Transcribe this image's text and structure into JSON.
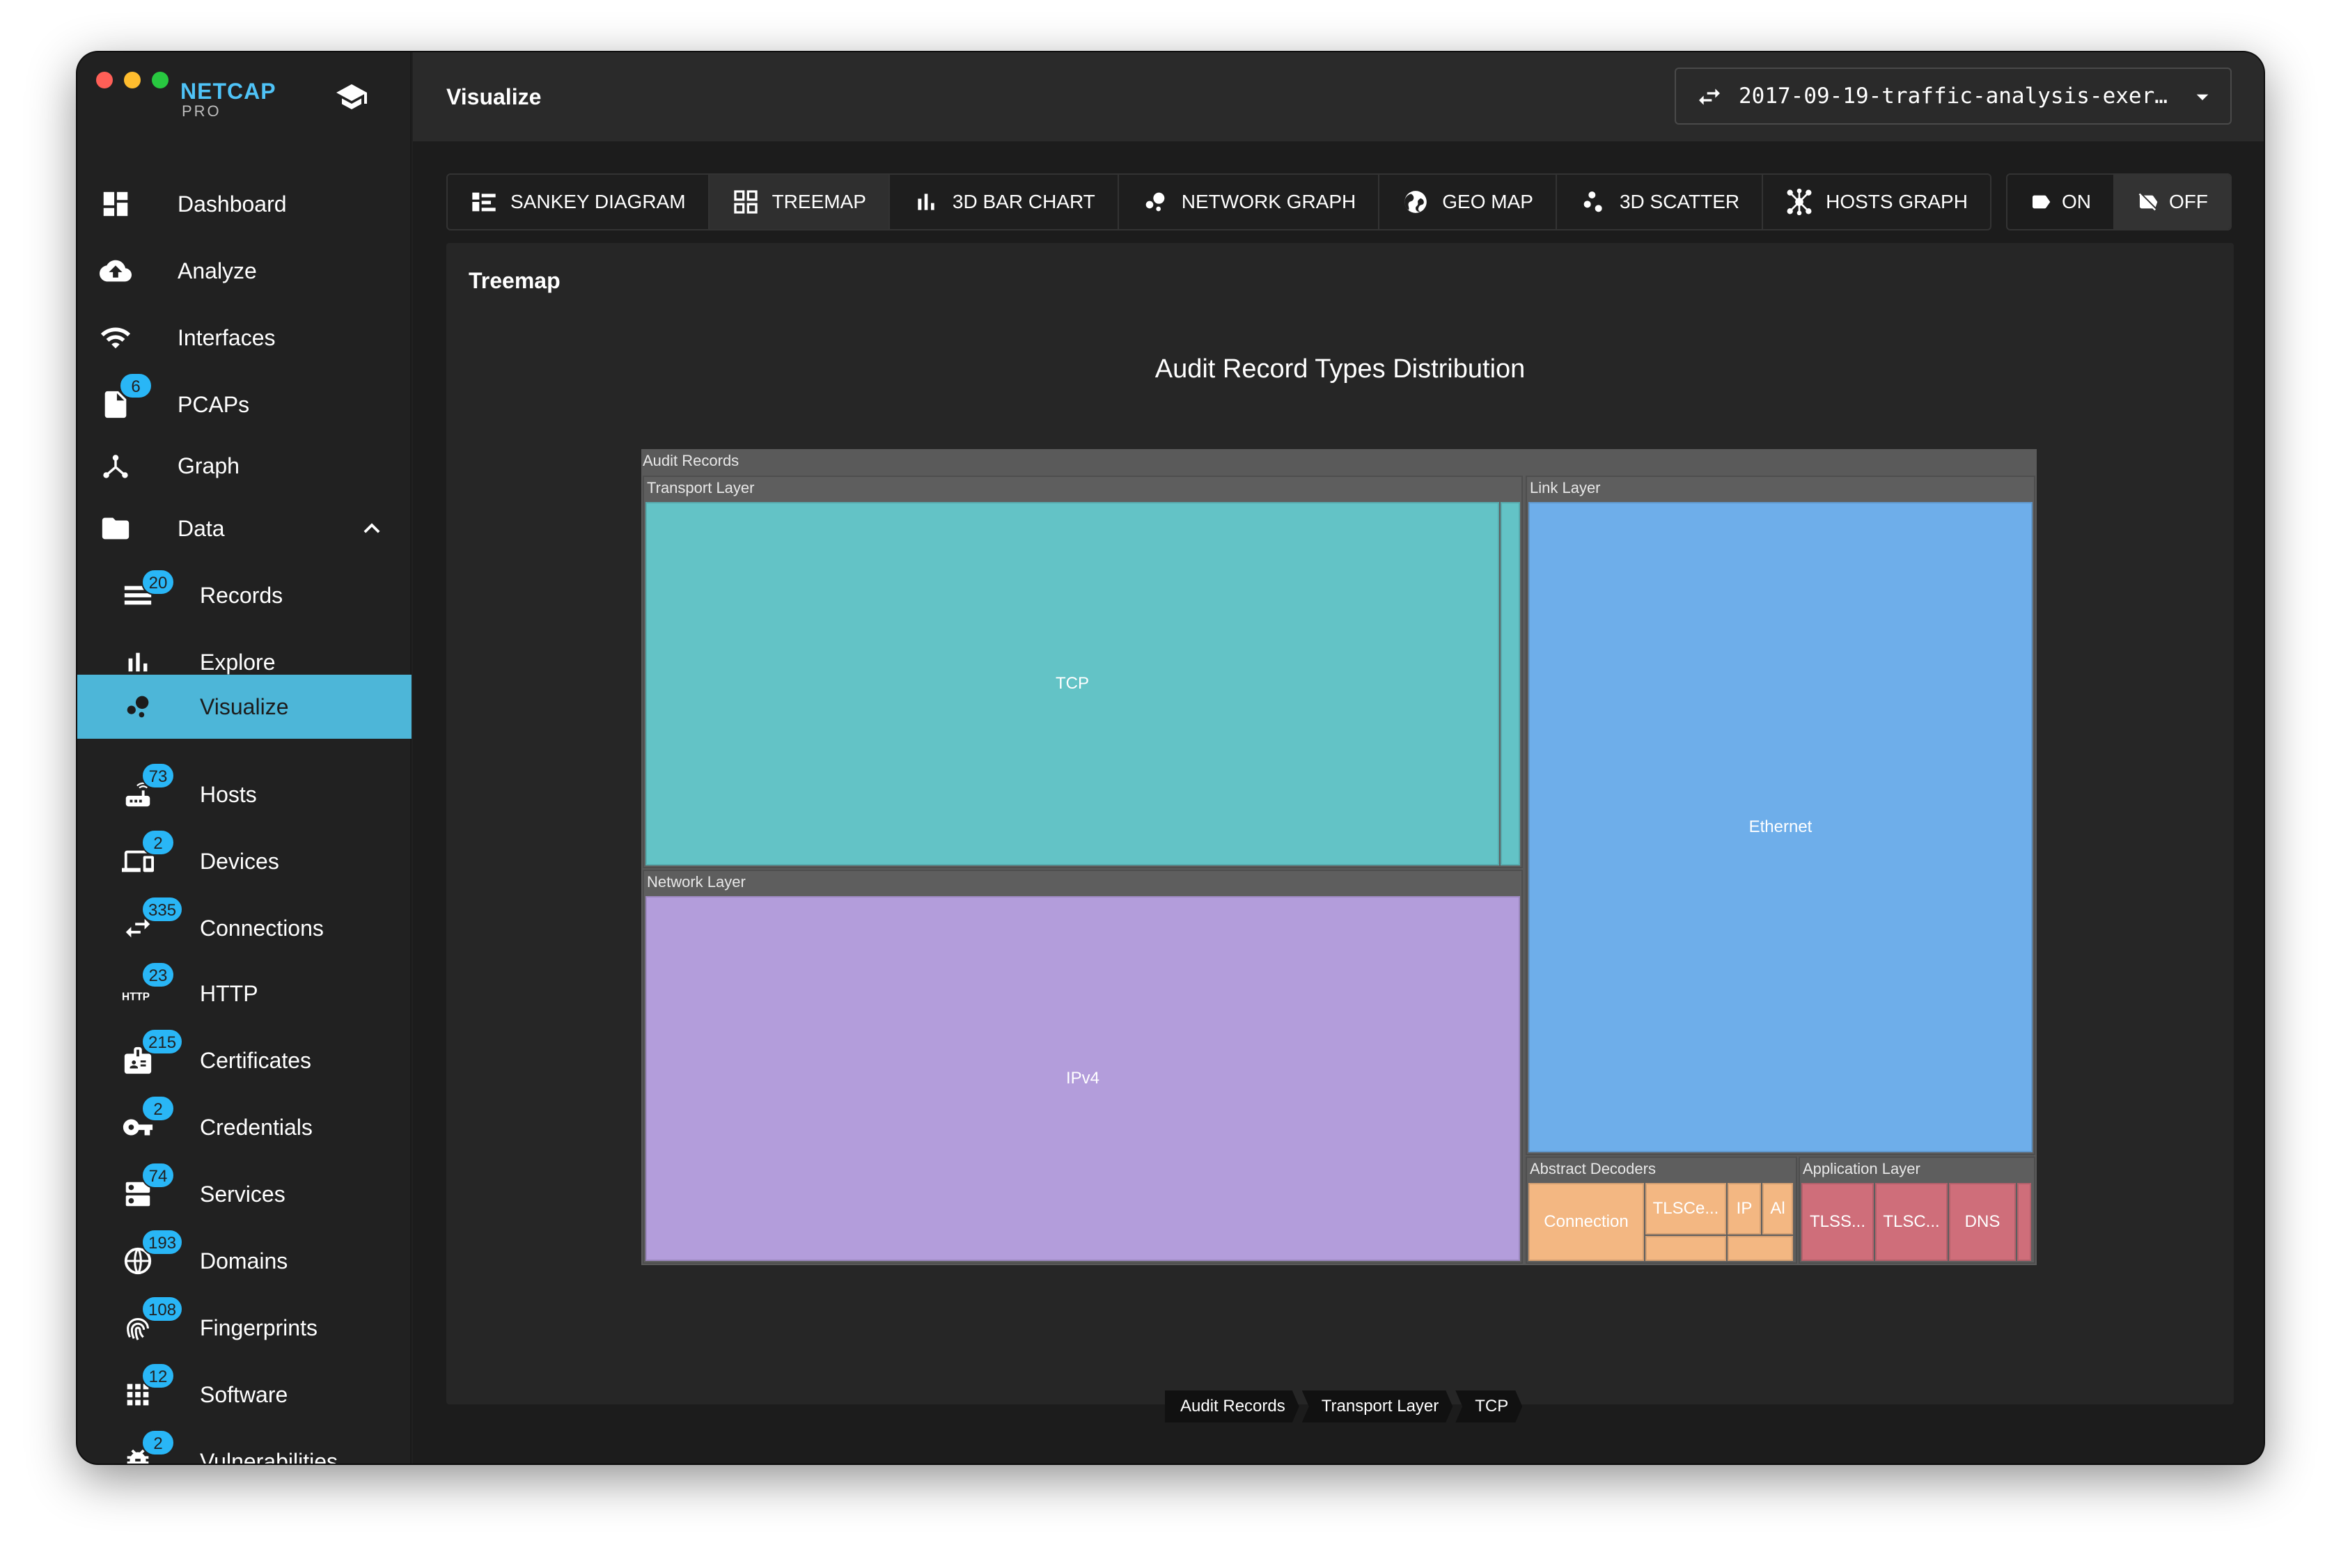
{
  "app": {
    "brand": "NETCAP",
    "edition": "PRO"
  },
  "nav": [
    {
      "label": "Dashboard",
      "icon": "dashboard-icon"
    },
    {
      "label": "Analyze",
      "icon": "cloud-upload-icon"
    },
    {
      "label": "Interfaces",
      "icon": "wifi-icon"
    },
    {
      "label": "PCAPs",
      "icon": "file-icon",
      "badge": "6"
    },
    {
      "label": "Graph",
      "icon": "graph-icon"
    },
    {
      "label": "Data",
      "icon": "folder-icon"
    },
    {
      "label": "Records",
      "icon": "records-icon",
      "badge": "20"
    },
    {
      "label": "Explore",
      "icon": "bar-chart-icon"
    },
    {
      "label": "Visualize",
      "icon": "bubble-chart-icon"
    },
    {
      "label": "Hosts",
      "icon": "router-icon",
      "badge": "73"
    },
    {
      "label": "Devices",
      "icon": "devices-icon",
      "badge": "2"
    },
    {
      "label": "Connections",
      "icon": "swap-arrows-icon",
      "badge": "335"
    },
    {
      "label": "HTTP",
      "icon": "http-icon",
      "badge": "23"
    },
    {
      "label": "Certificates",
      "icon": "certificate-icon",
      "badge": "215"
    },
    {
      "label": "Credentials",
      "icon": "key-icon",
      "badge": "2"
    },
    {
      "label": "Services",
      "icon": "server-icon",
      "badge": "74"
    },
    {
      "label": "Domains",
      "icon": "globe-icon",
      "badge": "193"
    },
    {
      "label": "Fingerprints",
      "icon": "fingerprint-icon",
      "badge": "108"
    },
    {
      "label": "Software",
      "icon": "apps-grid-icon",
      "badge": "12"
    },
    {
      "label": "Vulnerabilities",
      "icon": "bug-icon",
      "badge": "2"
    }
  ],
  "header": {
    "title": "Visualize",
    "file": "2017-09-19-traffic-analysis-exer…"
  },
  "tabs": [
    {
      "label": "SANKEY DIAGRAM",
      "icon": "sankey-icon"
    },
    {
      "label": "TREEMAP",
      "icon": "treemap-icon",
      "selected": true
    },
    {
      "label": "3D BAR CHART",
      "icon": "bar-chart-icon"
    },
    {
      "label": "NETWORK GRAPH",
      "icon": "network-icon"
    },
    {
      "label": "GEO MAP",
      "icon": "globe-icon"
    },
    {
      "label": "3D SCATTER",
      "icon": "scatter-icon"
    },
    {
      "label": "HOSTS GRAPH",
      "icon": "hub-icon"
    }
  ],
  "toggle": {
    "on": "ON",
    "off": "OFF"
  },
  "panel": {
    "title": "Treemap",
    "chart_title": "Audit Record Types Distribution"
  },
  "treemap": {
    "root": "Audit Records",
    "groups": {
      "transport": "Transport Layer",
      "network": "Network Layer",
      "link": "Link Layer",
      "abstract": "Abstract Decoders",
      "application": "Application Layer"
    },
    "leaves": {
      "tcp": "TCP",
      "ipv4": "IPv4",
      "ethernet": "Ethernet",
      "connection": "Connection",
      "tlsce": "TLSCe...",
      "ip": "IP",
      "al": "Al",
      "tlss": "TLSS...",
      "tlsc": "TLSC...",
      "dns": "DNS"
    },
    "colors": {
      "transport": "#63c3c6",
      "network": "#b39ddb",
      "link": "#6eaeea",
      "abstract": "#f3b782",
      "application": "#cf6e7a"
    }
  },
  "breadcrumbs": [
    "Audit Records",
    "Transport Layer",
    "TCP"
  ]
}
